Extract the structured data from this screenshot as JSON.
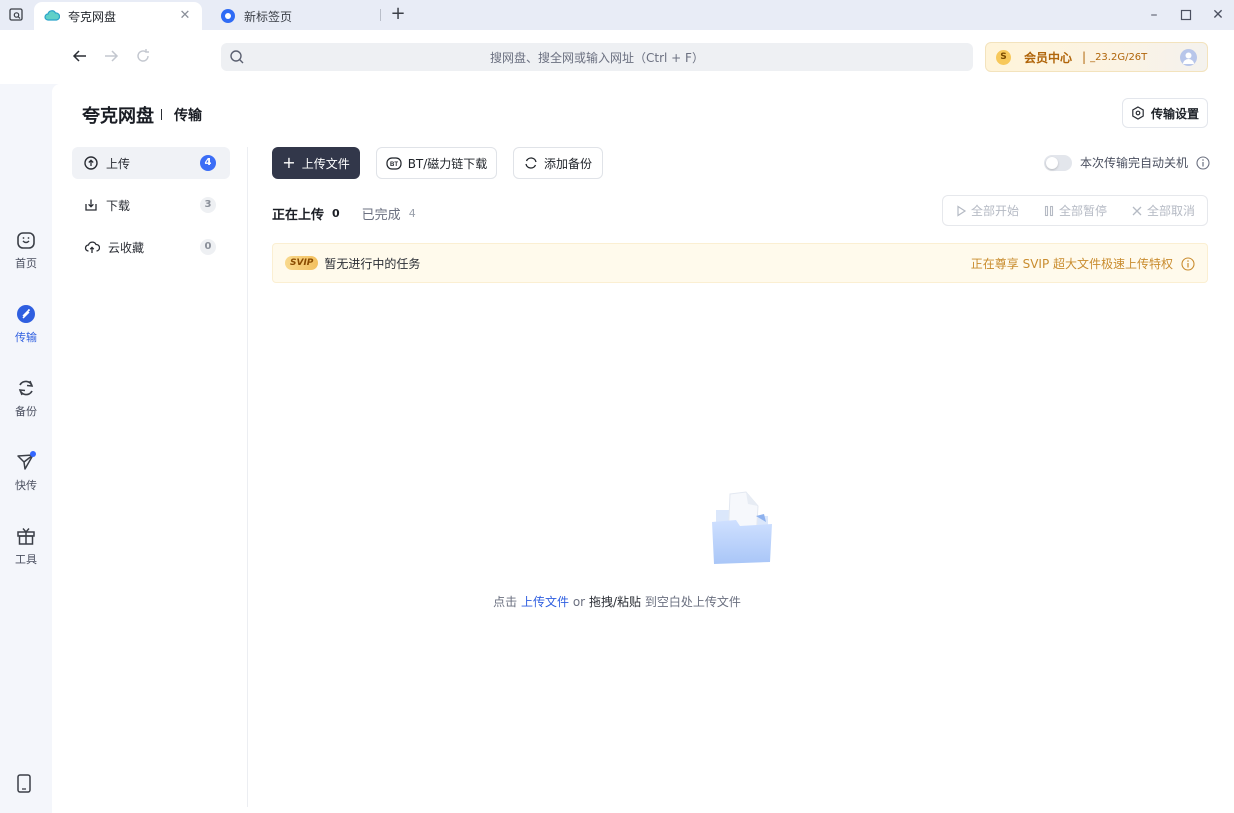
{
  "tabs": [
    {
      "title": "夸克网盘",
      "active": true
    },
    {
      "title": "新标签页",
      "active": false
    }
  ],
  "toolbar": {
    "address_placeholder": "搜网盘、搜全网或输入网址（Ctrl + F）",
    "vip_label": "会员中心",
    "vip_separator": "|",
    "storage": "_23.2G/26T",
    "vip_coin": "S"
  },
  "rail": [
    {
      "label": "首页",
      "icon": "smile-face-icon",
      "active": false
    },
    {
      "label": "传输",
      "icon": "transfer-icon",
      "active": true
    },
    {
      "label": "备份",
      "icon": "sync-icon",
      "active": false
    },
    {
      "label": "快传",
      "icon": "paper-plane-icon",
      "active": false
    },
    {
      "label": "工具",
      "icon": "gift-box-icon",
      "active": false
    }
  ],
  "header": {
    "brand": "夸克网盘",
    "section": "传输",
    "settings_label": "传输设置"
  },
  "subnav": [
    {
      "label": "上传",
      "count": "4",
      "active": true
    },
    {
      "label": "下载",
      "count": "3",
      "active": false
    },
    {
      "label": "云收藏",
      "count": "0",
      "active": false
    }
  ],
  "actions": {
    "upload": "上传文件",
    "bt": "BT/磁力链下载",
    "backup": "添加备份",
    "auto_shutdown": "本次传输完自动关机",
    "bt_icon_text": "BT"
  },
  "transfer_tabs": [
    {
      "label": "正在上传",
      "count": "0",
      "active": true
    },
    {
      "label": "已完成",
      "count": "4",
      "active": false
    }
  ],
  "bulk": {
    "start_all": "全部开始",
    "pause_all": "全部暂停",
    "cancel_all": "全部取消"
  },
  "banner": {
    "tag": "SVIP",
    "text": "暂无进行中的任务",
    "right": "正在尊享 SVIP 超大文件极速上传特权"
  },
  "empty": {
    "prefix": "点击",
    "link": "上传文件",
    "or": "or",
    "drag": "拖拽/粘贴",
    "suffix": "到空白处上传文件"
  },
  "colors": {
    "accent": "#2f5fe0",
    "primary_button": "#32374a",
    "vip_gold": "#c98c2e"
  }
}
